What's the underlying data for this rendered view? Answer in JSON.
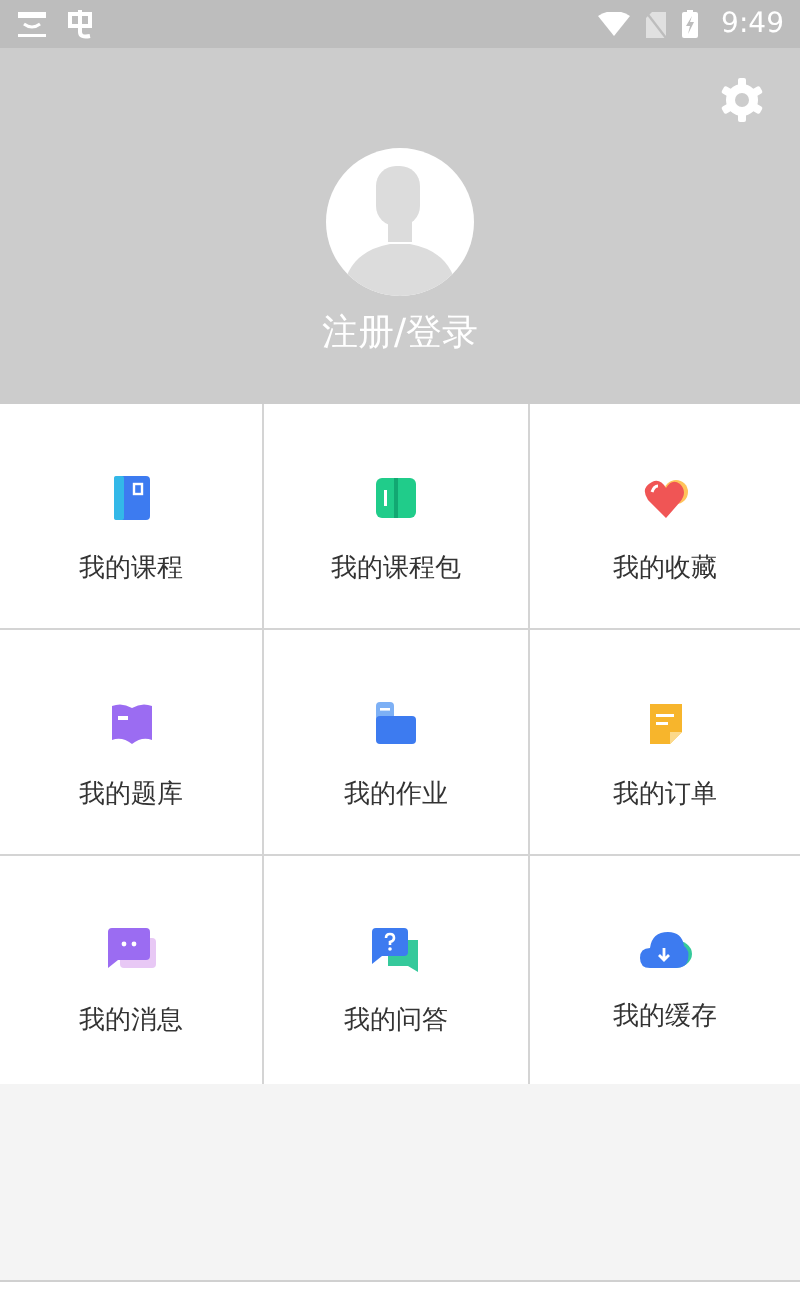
{
  "status_bar": {
    "time": "9:49"
  },
  "profile": {
    "login_label": "注册/登录"
  },
  "menu": [
    {
      "label": "我的课程",
      "kind": "book"
    },
    {
      "label": "我的课程包",
      "kind": "package"
    },
    {
      "label": "我的收藏",
      "kind": "heart"
    },
    {
      "label": "我的题库",
      "kind": "bank"
    },
    {
      "label": "我的作业",
      "kind": "homework"
    },
    {
      "label": "我的订单",
      "kind": "order"
    },
    {
      "label": "我的消息",
      "kind": "message"
    },
    {
      "label": "我的问答",
      "kind": "qa"
    },
    {
      "label": "我的缓存",
      "kind": "cache"
    }
  ]
}
